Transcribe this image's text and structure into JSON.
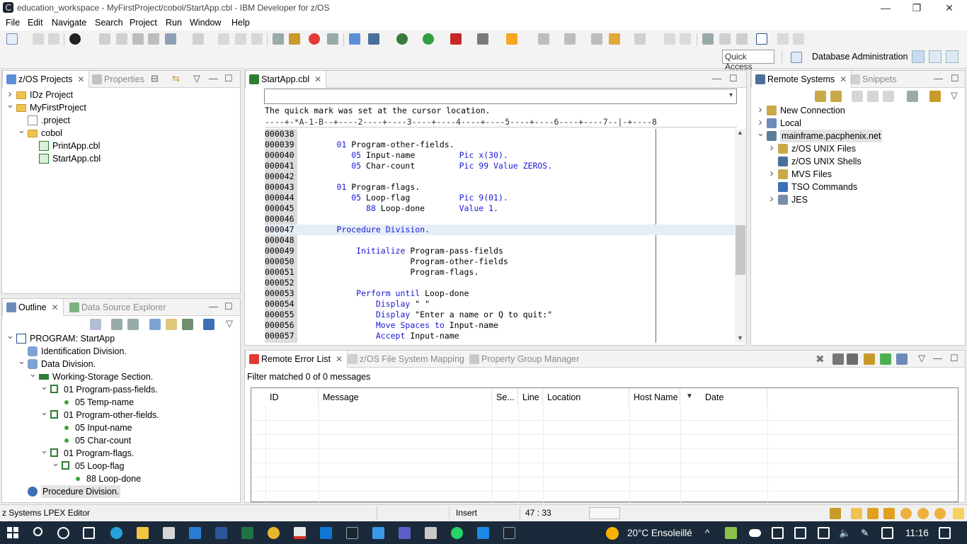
{
  "window": {
    "title": "education_workspace - MyFirstProject/cobol/StartApp.cbl - IBM Developer for z/OS",
    "minimize": "—",
    "restore": "❐",
    "close": "✕"
  },
  "menu": [
    "File",
    "Edit",
    "Navigate",
    "Search",
    "Project",
    "Run",
    "Window",
    "Help"
  ],
  "toolbar": {
    "quick_access": "Quick Access",
    "perspective_label": "Database Administration"
  },
  "left_panel": {
    "tabs": [
      {
        "label": "z/OS Projects",
        "active": true
      },
      {
        "label": "Properties",
        "active": false
      }
    ],
    "tree": [
      {
        "label": "IDz Project",
        "level": 0,
        "expanded": false,
        "icon": "project-folder-icon"
      },
      {
        "label": "MyFirstProject",
        "level": 0,
        "expanded": true,
        "icon": "project-folder-icon"
      },
      {
        "label": ".project",
        "level": 1,
        "icon": "file-icon"
      },
      {
        "label": "cobol",
        "level": 1,
        "expanded": true,
        "icon": "folder-icon"
      },
      {
        "label": "PrintApp.cbl",
        "level": 2,
        "icon": "cobol-file-icon"
      },
      {
        "label": "StartApp.cbl",
        "level": 2,
        "icon": "cobol-file-icon"
      }
    ]
  },
  "outline_panel": {
    "tabs": [
      {
        "label": "Outline",
        "active": true
      },
      {
        "label": "Data Source Explorer",
        "active": false
      }
    ],
    "tree": [
      {
        "label": "PROGRAM: StartApp",
        "level": 0,
        "expanded": true
      },
      {
        "label": "Identification Division.",
        "level": 1
      },
      {
        "label": "Data Division.",
        "level": 1,
        "expanded": true
      },
      {
        "label": "Working-Storage Section.",
        "level": 2,
        "expanded": true
      },
      {
        "label": "01 Program-pass-fields.",
        "level": 3,
        "expanded": true
      },
      {
        "label": "05 Temp-name",
        "level": 4
      },
      {
        "label": "01 Program-other-fields.",
        "level": 3,
        "expanded": true
      },
      {
        "label": "05 Input-name",
        "level": 4
      },
      {
        "label": "05 Char-count",
        "level": 4
      },
      {
        "label": "01 Program-flags.",
        "level": 3,
        "expanded": true
      },
      {
        "label": "05 Loop-flag",
        "level": 4,
        "expanded": true
      },
      {
        "label": "88 Loop-done",
        "level": 5
      },
      {
        "label": "Procedure Division.",
        "level": 1,
        "selected": true
      }
    ]
  },
  "editor": {
    "tab_label": "StartApp.cbl",
    "message": "The quick mark was set at the cursor location.",
    "ruler": "----+-*A-1-B--+----2----+----3----+----4----+----5----+----6----+----7--|-+----8",
    "lines": [
      {
        "num": "000038",
        "code": "",
        "current": false
      },
      {
        "num": "000039",
        "code": "       01 Program-other-fields.",
        "current": false
      },
      {
        "num": "000040",
        "code": "          05 Input-name         Pic x(30).",
        "current": false
      },
      {
        "num": "000041",
        "code": "          05 Char-count         Pic 99 Value ZEROS.",
        "current": false
      },
      {
        "num": "000042",
        "code": "",
        "current": false
      },
      {
        "num": "000043",
        "code": "       01 Program-flags.",
        "current": false
      },
      {
        "num": "000044",
        "code": "          05 Loop-flag          Pic 9(01).",
        "current": false
      },
      {
        "num": "000045",
        "code": "             88 Loop-done       Value 1.",
        "current": false
      },
      {
        "num": "000046",
        "code": "",
        "current": false
      },
      {
        "num": "000047",
        "code": "       Procedure Division.",
        "current": true
      },
      {
        "num": "000048",
        "code": "",
        "current": false
      },
      {
        "num": "000049",
        "code": "           Initialize Program-pass-fields",
        "current": false
      },
      {
        "num": "000050",
        "code": "                      Program-other-fields",
        "current": false
      },
      {
        "num": "000051",
        "code": "                      Program-flags.",
        "current": false
      },
      {
        "num": "000052",
        "code": "",
        "current": false
      },
      {
        "num": "000053",
        "code": "           Perform until Loop-done",
        "current": false
      },
      {
        "num": "000054",
        "code": "               Display \" \"",
        "current": false
      },
      {
        "num": "000055",
        "code": "               Display \"Enter a name or Q to quit:\"",
        "current": false
      },
      {
        "num": "000056",
        "code": "               Move Spaces to Input-name",
        "current": false
      },
      {
        "num": "000057",
        "code": "               Accept Input-name",
        "current": false
      }
    ]
  },
  "remote_systems": {
    "tabs": [
      {
        "label": "Remote Systems",
        "active": true
      },
      {
        "label": "Snippets",
        "active": false
      }
    ],
    "tree": [
      {
        "label": "New Connection",
        "level": 0,
        "expanded": false
      },
      {
        "label": "Local",
        "level": 0,
        "expanded": false
      },
      {
        "label": "mainframe.pacphenix.net",
        "level": 0,
        "expanded": true,
        "selected": true
      },
      {
        "label": "z/OS UNIX Files",
        "level": 1,
        "expanded": false
      },
      {
        "label": "z/OS UNIX Shells",
        "level": 1
      },
      {
        "label": "MVS Files",
        "level": 1,
        "expanded": false
      },
      {
        "label": "TSO Commands",
        "level": 1
      },
      {
        "label": "JES",
        "level": 1,
        "expanded": false
      }
    ]
  },
  "error_panel": {
    "tabs": [
      {
        "label": "Remote Error List",
        "active": true
      },
      {
        "label": "z/OS File System Mapping",
        "active": false
      },
      {
        "label": "Property Group Manager",
        "active": false
      }
    ],
    "filter_text": "Filter matched 0 of 0 messages",
    "columns": [
      "ID",
      "Message",
      "Se...",
      "Line",
      "Location",
      "Host Name",
      "Date"
    ]
  },
  "status": {
    "editor_name": "z Systems LPEX Editor",
    "mode": "Insert",
    "position": "47 : 33"
  },
  "taskbar": {
    "weather": "20°C  Ensoleillé",
    "time": "11:16"
  },
  "colors": {
    "keyword": "#1a1ad6",
    "taskbar_bg": "#1b2a3a",
    "current_line": "#e5edf7"
  }
}
